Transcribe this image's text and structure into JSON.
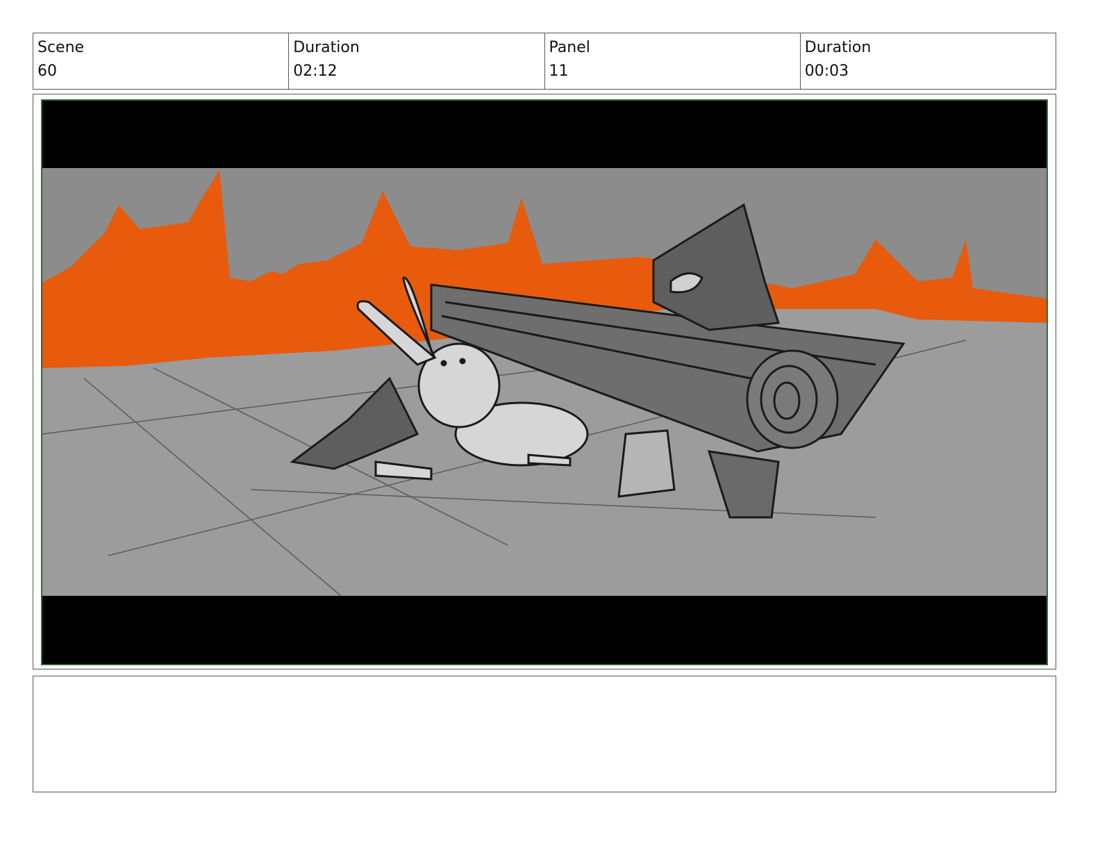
{
  "header": {
    "scene_label": "Scene",
    "scene_value": "60",
    "duration_label": "Duration",
    "duration_value": "02:12",
    "panel_label": "Panel",
    "panel_value": "11",
    "panel_duration_label": "Duration",
    "panel_duration_value": "00:03"
  },
  "artwork": {
    "frame_color": "#2e6b2e",
    "sky_color": "#8c8c8c",
    "flame_color": "#e85a0c",
    "ground_color": "#9a9a9a"
  },
  "notes": {
    "text": ""
  }
}
